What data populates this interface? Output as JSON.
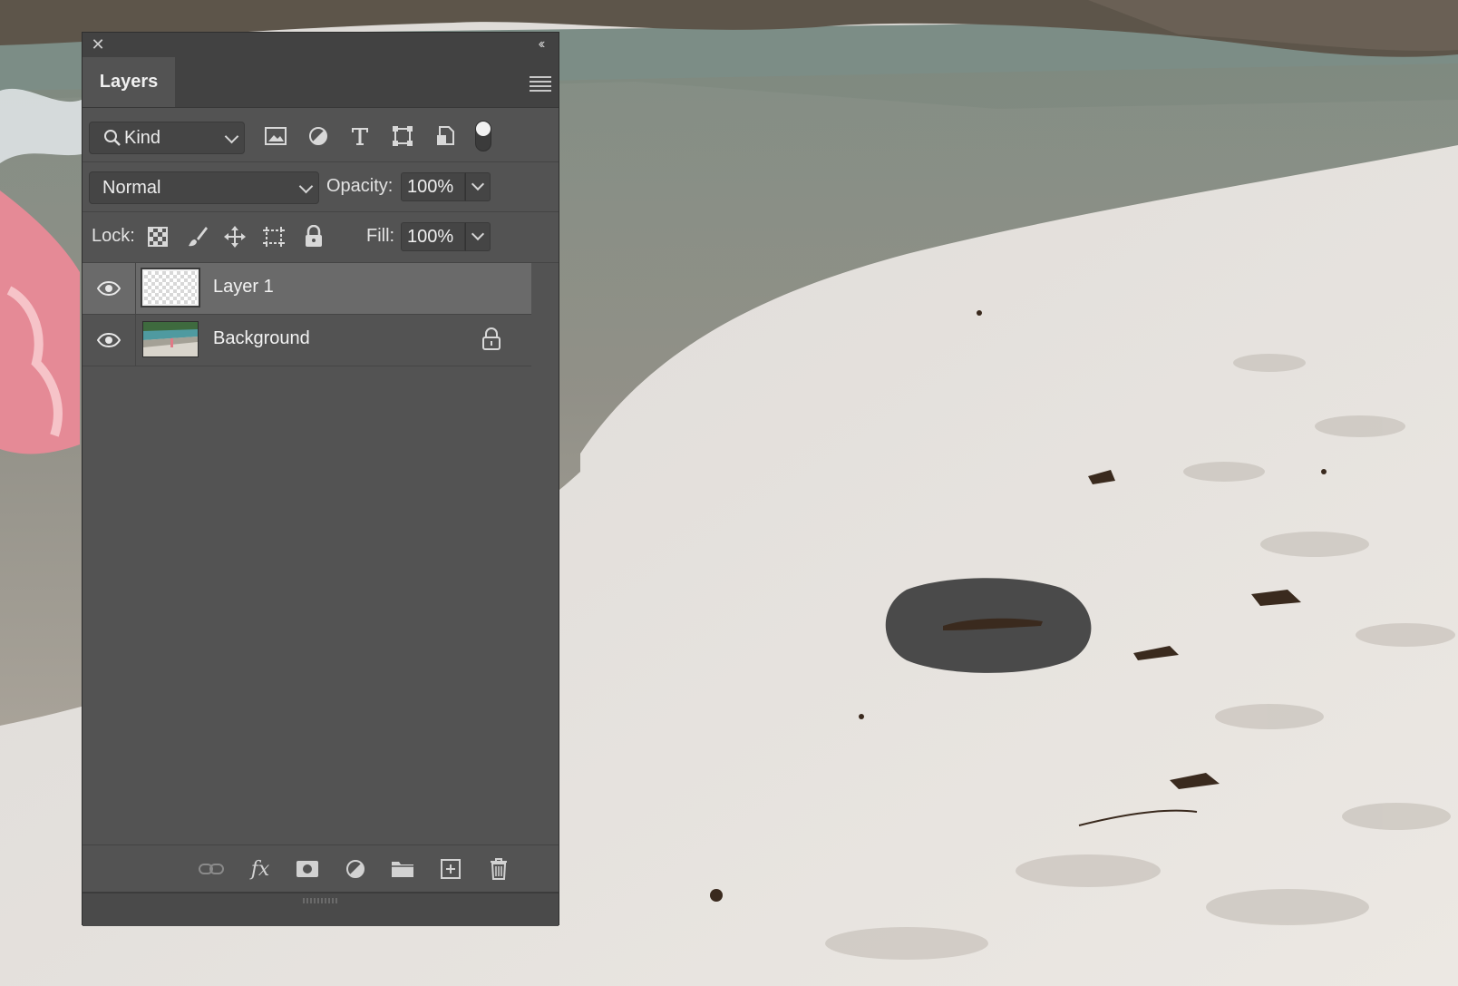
{
  "panel": {
    "tab_label": "Layers",
    "filter": {
      "kind_label": "Kind"
    },
    "blend_mode": "Normal",
    "opacity_label": "Opacity:",
    "opacity_value": "100%",
    "lock_label": "Lock:",
    "fill_label": "Fill:",
    "fill_value": "100%",
    "layers": [
      {
        "name": "Layer 1",
        "visible": true,
        "selected": true,
        "locked": false,
        "thumbnail": "transparent-checkerboard"
      },
      {
        "name": "Background",
        "visible": true,
        "selected": false,
        "locked": true,
        "thumbnail": "beach-photo"
      }
    ]
  },
  "icons": {
    "close": "close-icon",
    "collapse": "collapse-icon",
    "menu": "panel-menu-icon",
    "filter_pixel": "image-filter-icon",
    "filter_adjustment": "adjustment-filter-icon",
    "filter_type": "type-filter-icon",
    "filter_shape": "shape-filter-icon",
    "filter_smart": "smart-object-filter-icon",
    "footer": [
      "link-icon",
      "fx-icon",
      "mask-icon",
      "adjustment-layer-icon",
      "folder-icon",
      "new-layer-icon",
      "trash-icon"
    ]
  },
  "colors": {
    "panel_bg": "#535353",
    "panel_header": "#424242",
    "selected_row": "#6a6a6a",
    "text": "#e6e6e6"
  }
}
